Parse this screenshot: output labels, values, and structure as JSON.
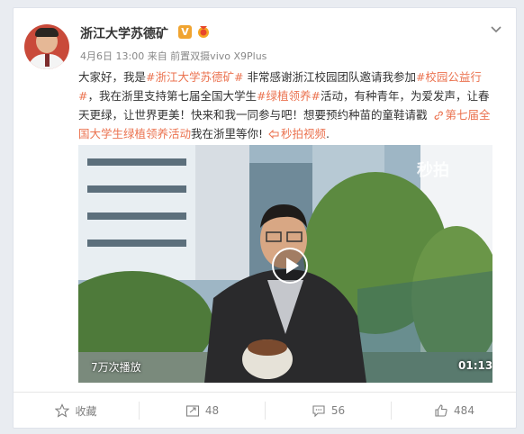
{
  "post": {
    "author": "浙江大学苏德矿",
    "meta": "4月6日 13:00 来自 前置双摄vivo X9Plus",
    "text": {
      "p1": "大家好，我是",
      "mention": "#浙江大学苏德矿#",
      "p2": " 非常感谢浙江校园团队邀请我参加",
      "tag1": "#校园公益行#",
      "p3": "，我在浙里支持第七届全国大学生",
      "tag2": "#绿植领养#",
      "p4": "活动，有种青年，为爱发声，让春天更绿，让世界更美！快来和我一同参与吧！想要预约种苗的童鞋请戳",
      "link": "第七届全国大学生绿植领养活动",
      "p5": "我在浙里等你!",
      "video_link": "秒拍视频",
      "tail": "."
    }
  },
  "video": {
    "watermark": "秒拍",
    "plays": "7万次播放",
    "duration": "01:13"
  },
  "actions": {
    "favorite": "收藏",
    "repost": "48",
    "comment": "56",
    "like": "484"
  },
  "colors": {
    "accent": "#eb7350",
    "verified": "#f0a431"
  }
}
